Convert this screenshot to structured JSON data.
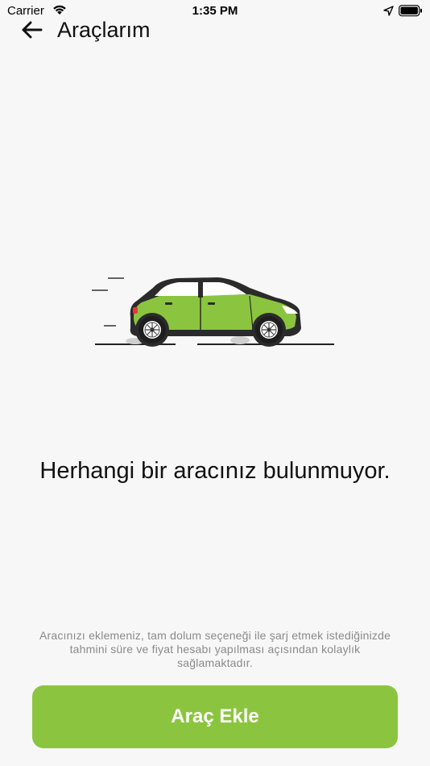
{
  "status_bar": {
    "carrier": "Carrier",
    "time": "1:35 PM",
    "icons": [
      "wifi-icon",
      "location-icon",
      "battery-icon"
    ]
  },
  "header": {
    "back_icon": "arrow-left-icon",
    "title": "Araçlarım"
  },
  "empty_state": {
    "illustration": "car-illustration",
    "message": "Herhangi bir aracınız bulunmuyor.",
    "description": "Aracınızı eklemeniz, tam dolum seçeneği ile şarj etmek istediğinizde tahmini süre ve fiyat hesabı yapılması açısından kolaylık sağlamaktadır."
  },
  "actions": {
    "add_vehicle_label": "Araç Ekle"
  },
  "colors": {
    "background": "#f7f7f7",
    "accent": "#8bc53f",
    "car_body": "#8bc53f",
    "car_dark": "#2b2b2b"
  }
}
